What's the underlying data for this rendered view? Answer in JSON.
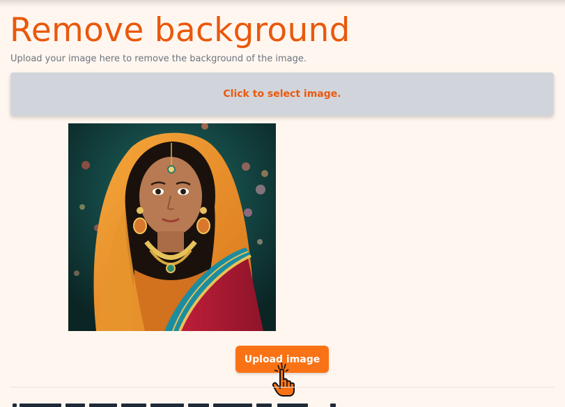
{
  "header": {
    "title": "Remove background",
    "subtitle": "Upload your image here to remove the background of the image."
  },
  "dropzone": {
    "label": "Click to select image."
  },
  "preview": {
    "icon": "portrait-image"
  },
  "actions": {
    "upload_label": "Upload image"
  },
  "colors": {
    "accent": "#ea580c",
    "button": "#f97316",
    "background": "#fff7ef",
    "dropzone": "#d1d5db"
  }
}
